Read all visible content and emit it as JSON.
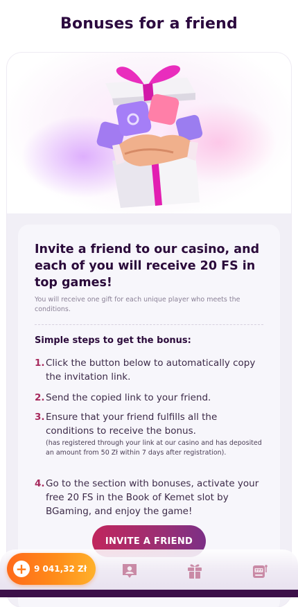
{
  "page": {
    "title": "Bonuses for a friend"
  },
  "offer": {
    "headline": "Invite a friend to our casino, and each of you will receive 20 FS in top games!",
    "subtext": "You will receive one gift for each unique player who meets the conditions."
  },
  "steps": {
    "title": "Simple steps to get the bonus:",
    "items": [
      {
        "num": "1.",
        "text": "Click the button below to automatically copy the invitation link.",
        "note": ""
      },
      {
        "num": "2.",
        "text": "Send the copied link to your friend.",
        "note": ""
      },
      {
        "num": "3.",
        "text": "Ensure that your friend fulfills all the conditions to receive the bonus.",
        "note": "(has registered through your link at our casino and has deposited an amount from 50 Zł within 7 days after registration)."
      },
      {
        "num": "4.",
        "text": "Go to the section with bonuses, activate your free 20 FS in the Book of Kemet slot by BGaming, and enjoy the game!",
        "note": ""
      }
    ]
  },
  "actions": {
    "invite_label": "INVITE A FRIEND"
  },
  "bottom_bar": {
    "balance": "9 041,32 Zł",
    "plus_glyph": "+",
    "icons": [
      "profile-badge-icon",
      "gift-icon",
      "slot-machine-icon"
    ]
  },
  "colors": {
    "title": "#2c0a3f",
    "step_number": "#a72a5d",
    "button_start": "#c0265d",
    "button_end": "#7c2f86",
    "balance_start": "#ff6a1a",
    "balance_end": "#ffb12b"
  }
}
